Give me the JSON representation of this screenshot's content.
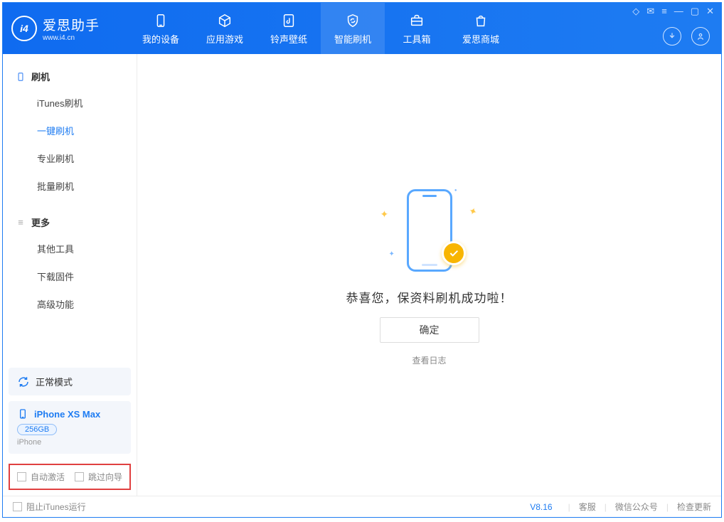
{
  "brand": {
    "name": "爱思助手",
    "url": "www.i4.cn"
  },
  "nav": {
    "device": "我的设备",
    "apps": "应用游戏",
    "rings": "铃声壁纸",
    "flash": "智能刷机",
    "toolbox": "工具箱",
    "store": "爱思商城"
  },
  "sidebar": {
    "group_flash": "刷机",
    "items_flash": {
      "itunes": "iTunes刷机",
      "onekey": "一键刷机",
      "pro": "专业刷机",
      "batch": "批量刷机"
    },
    "group_more": "更多",
    "items_more": {
      "other": "其他工具",
      "firmware": "下载固件",
      "advanced": "高级功能"
    }
  },
  "device": {
    "mode": "正常模式",
    "name": "iPhone XS Max",
    "capacity": "256GB",
    "type": "iPhone"
  },
  "options": {
    "auto_activate": "自动激活",
    "skip_guide": "跳过向导"
  },
  "main": {
    "success_text": "恭喜您，保资料刷机成功啦！",
    "ok_button": "确定",
    "view_log": "查看日志"
  },
  "bottom": {
    "stop_itunes": "阻止iTunes运行",
    "version": "V8.16",
    "support": "客服",
    "wechat": "微信公众号",
    "update": "检查更新"
  }
}
